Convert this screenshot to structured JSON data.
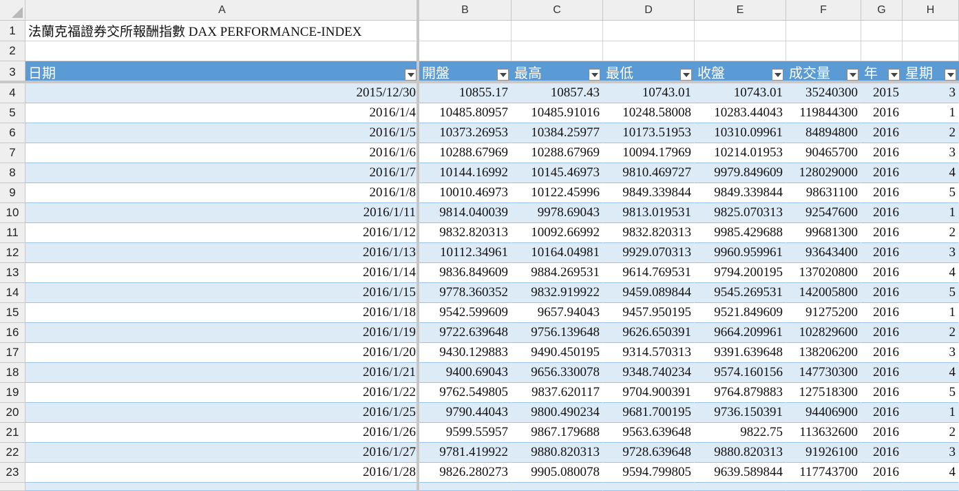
{
  "sheet": {
    "title": "法蘭克福證券交所報酬指數 DAX PERFORMANCE-INDEX",
    "columns": [
      "A",
      "B",
      "C",
      "D",
      "E",
      "F",
      "G",
      "H"
    ],
    "table_headers": [
      "日期",
      "開盤",
      "最高",
      "最低",
      "收盤",
      "成交量",
      "年",
      "星期"
    ],
    "rows": [
      {
        "n": "4",
        "cells": [
          "2015/12/30",
          "10855.17",
          "10857.43",
          "10743.01",
          "10743.01",
          "35240300",
          "2015",
          "3"
        ]
      },
      {
        "n": "5",
        "cells": [
          "2016/1/4",
          "10485.80957",
          "10485.91016",
          "10248.58008",
          "10283.44043",
          "119844300",
          "2016",
          "1"
        ]
      },
      {
        "n": "6",
        "cells": [
          "2016/1/5",
          "10373.26953",
          "10384.25977",
          "10173.51953",
          "10310.09961",
          "84894800",
          "2016",
          "2"
        ]
      },
      {
        "n": "7",
        "cells": [
          "2016/1/6",
          "10288.67969",
          "10288.67969",
          "10094.17969",
          "10214.01953",
          "90465700",
          "2016",
          "3"
        ]
      },
      {
        "n": "8",
        "cells": [
          "2016/1/7",
          "10144.16992",
          "10145.46973",
          "9810.469727",
          "9979.849609",
          "128029000",
          "2016",
          "4"
        ]
      },
      {
        "n": "9",
        "cells": [
          "2016/1/8",
          "10010.46973",
          "10122.45996",
          "9849.339844",
          "9849.339844",
          "98631100",
          "2016",
          "5"
        ]
      },
      {
        "n": "10",
        "cells": [
          "2016/1/11",
          "9814.040039",
          "9978.69043",
          "9813.019531",
          "9825.070313",
          "92547600",
          "2016",
          "1"
        ]
      },
      {
        "n": "11",
        "cells": [
          "2016/1/12",
          "9832.820313",
          "10092.66992",
          "9832.820313",
          "9985.429688",
          "99681300",
          "2016",
          "2"
        ]
      },
      {
        "n": "12",
        "cells": [
          "2016/1/13",
          "10112.34961",
          "10164.04981",
          "9929.070313",
          "9960.959961",
          "93643400",
          "2016",
          "3"
        ]
      },
      {
        "n": "13",
        "cells": [
          "2016/1/14",
          "9836.849609",
          "9884.269531",
          "9614.769531",
          "9794.200195",
          "137020800",
          "2016",
          "4"
        ]
      },
      {
        "n": "14",
        "cells": [
          "2016/1/15",
          "9778.360352",
          "9832.919922",
          "9459.089844",
          "9545.269531",
          "142005800",
          "2016",
          "5"
        ]
      },
      {
        "n": "15",
        "cells": [
          "2016/1/18",
          "9542.599609",
          "9657.94043",
          "9457.950195",
          "9521.849609",
          "91275200",
          "2016",
          "1"
        ]
      },
      {
        "n": "16",
        "cells": [
          "2016/1/19",
          "9722.639648",
          "9756.139648",
          "9626.650391",
          "9664.209961",
          "102829600",
          "2016",
          "2"
        ]
      },
      {
        "n": "17",
        "cells": [
          "2016/1/20",
          "9430.129883",
          "9490.450195",
          "9314.570313",
          "9391.639648",
          "138206200",
          "2016",
          "3"
        ]
      },
      {
        "n": "18",
        "cells": [
          "2016/1/21",
          "9400.69043",
          "9656.330078",
          "9348.740234",
          "9574.160156",
          "147730300",
          "2016",
          "4"
        ]
      },
      {
        "n": "19",
        "cells": [
          "2016/1/22",
          "9762.549805",
          "9837.620117",
          "9704.900391",
          "9764.879883",
          "127518300",
          "2016",
          "5"
        ]
      },
      {
        "n": "20",
        "cells": [
          "2016/1/25",
          "9790.44043",
          "9800.490234",
          "9681.700195",
          "9736.150391",
          "94406900",
          "2016",
          "1"
        ]
      },
      {
        "n": "21",
        "cells": [
          "2016/1/26",
          "9599.55957",
          "9867.179688",
          "9563.639648",
          "9822.75",
          "113632600",
          "2016",
          "2"
        ]
      },
      {
        "n": "22",
        "cells": [
          "2016/1/27",
          "9781.419922",
          "9880.820313",
          "9728.639648",
          "9880.820313",
          "91926100",
          "2016",
          "3"
        ]
      },
      {
        "n": "23",
        "cells": [
          "2016/1/28",
          "9826.280273",
          "9905.080078",
          "9594.799805",
          "9639.589844",
          "117743700",
          "2016",
          "4"
        ]
      }
    ]
  }
}
